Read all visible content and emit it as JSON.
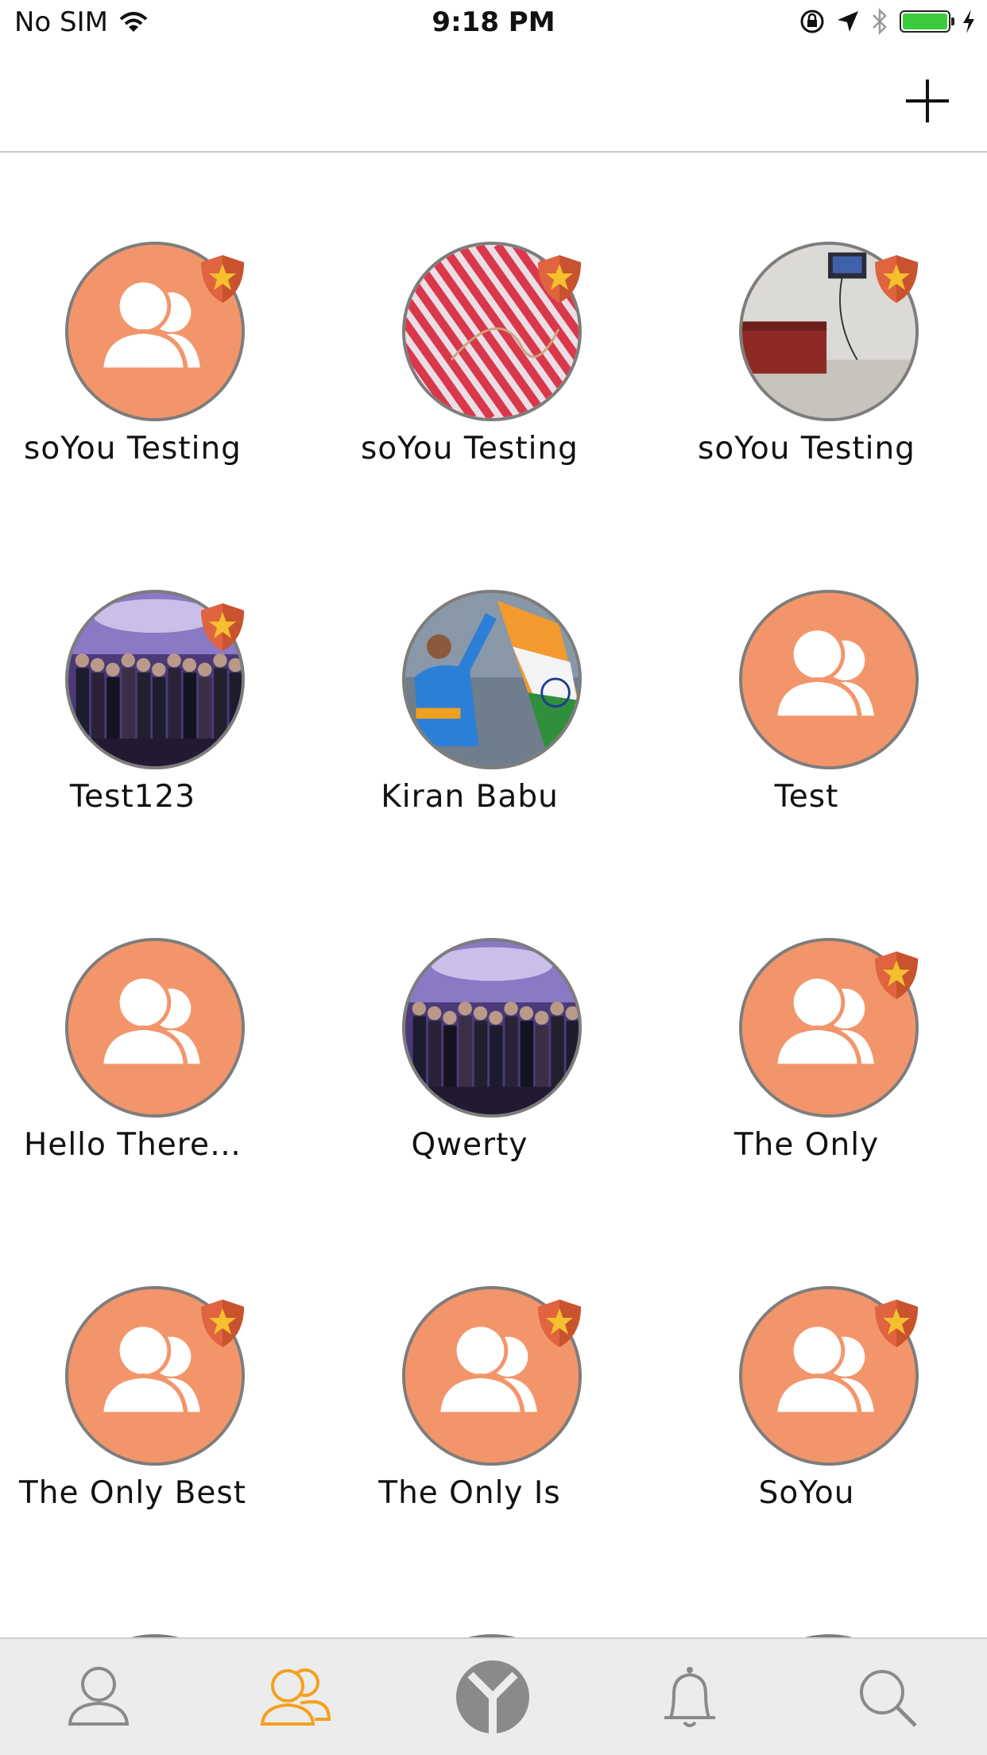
{
  "status_bar": {
    "carrier": "No SIM",
    "time": "9:18 PM",
    "battery_level": 1.0,
    "battery_color": "#3ccb3c"
  },
  "nav": {
    "add_button_icon": "plus-icon"
  },
  "colors": {
    "avatar_orange": "#f3956a",
    "tab_active": "#f5a020",
    "tab_inactive": "#8a8a8a"
  },
  "groups": [
    {
      "name": "soYou Testing",
      "avatar": "default",
      "badge": true
    },
    {
      "name": "soYou Testing",
      "avatar": "photo-stripes",
      "badge": true
    },
    {
      "name": "soYou Testing",
      "avatar": "photo-room",
      "badge": true
    },
    {
      "name": "Test123",
      "avatar": "photo-crowd",
      "badge": true
    },
    {
      "name": "Kiran Babu",
      "avatar": "photo-cricket",
      "badge": false
    },
    {
      "name": "Test",
      "avatar": "default",
      "badge": false
    },
    {
      "name": "Hello There…",
      "avatar": "default",
      "badge": false
    },
    {
      "name": "Qwerty",
      "avatar": "photo-crowd",
      "badge": false
    },
    {
      "name": "The Only",
      "avatar": "default",
      "badge": true
    },
    {
      "name": "The Only Best",
      "avatar": "default",
      "badge": true
    },
    {
      "name": "The Only Is",
      "avatar": "default",
      "badge": true
    },
    {
      "name": "SoYou",
      "avatar": "default",
      "badge": true
    }
  ],
  "tabs": [
    {
      "icon": "profile-icon",
      "active": false
    },
    {
      "icon": "groups-icon",
      "active": true
    },
    {
      "icon": "soyou-logo-icon",
      "active": false
    },
    {
      "icon": "bell-icon",
      "active": false
    },
    {
      "icon": "search-icon",
      "active": false
    }
  ]
}
